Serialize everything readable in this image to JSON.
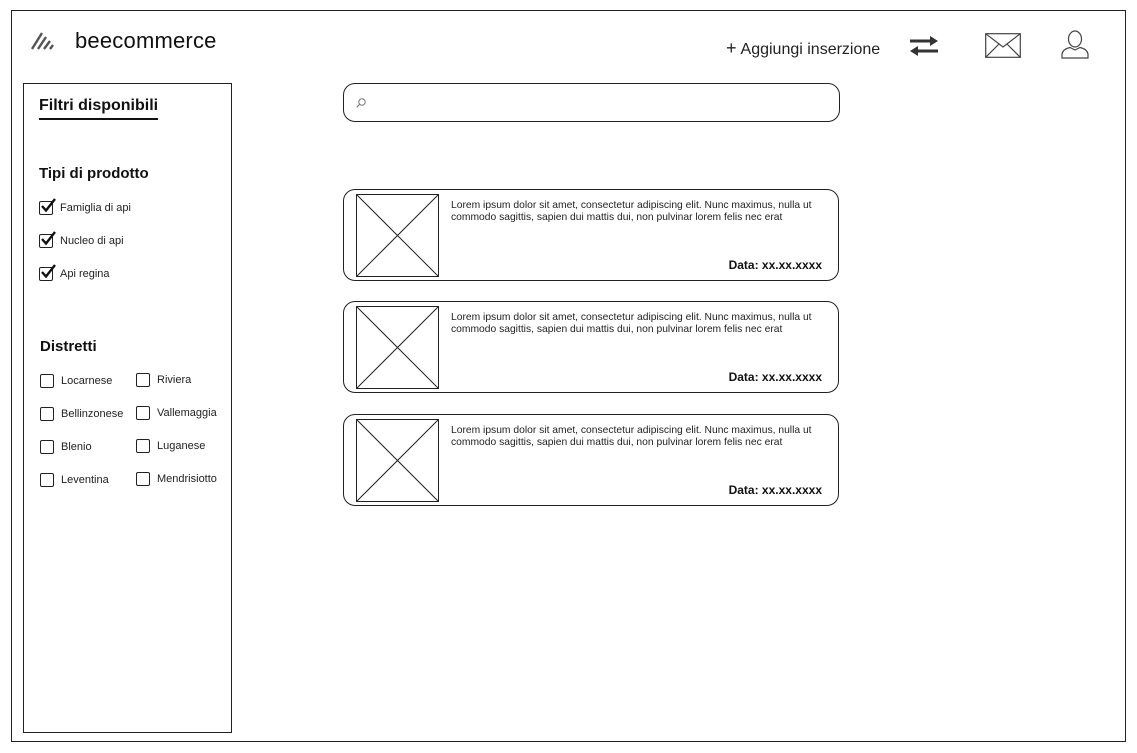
{
  "header": {
    "brand": "beecommerce",
    "add_listing_plus": "+",
    "add_listing_label": "Aggiungi inserzione",
    "icons": [
      "logo-icon",
      "swap-arrows-icon",
      "mail-icon",
      "user-icon"
    ]
  },
  "sidebar": {
    "title": "Filtri disponibili",
    "product_types": {
      "heading": "Tipi di prodotto",
      "items": [
        {
          "label": "Famiglia di api",
          "checked": true
        },
        {
          "label": "Nucleo di api",
          "checked": true
        },
        {
          "label": "Api regina",
          "checked": true
        }
      ]
    },
    "districts": {
      "heading": "Distretti",
      "items": [
        {
          "label": "Locarnese",
          "checked": false
        },
        {
          "label": "Riviera",
          "checked": false
        },
        {
          "label": "Bellinzonese",
          "checked": false
        },
        {
          "label": "Vallemaggia",
          "checked": false
        },
        {
          "label": "Blenio",
          "checked": false
        },
        {
          "label": "Luganese",
          "checked": false
        },
        {
          "label": "Leventina",
          "checked": false
        },
        {
          "label": "Mendrisiotto",
          "checked": false
        }
      ]
    }
  },
  "search": {
    "value": "",
    "placeholder": ""
  },
  "listings": [
    {
      "description": "Lorem ipsum dolor sit amet, consectetur adipiscing elit. Nunc maximus, nulla ut commodo sagittis, sapien dui mattis dui, non pulvinar lorem felis nec erat",
      "date": "Data: xx.xx.xxxx"
    },
    {
      "description": "Lorem ipsum dolor sit amet, consectetur adipiscing elit. Nunc maximus, nulla ut commodo sagittis, sapien dui mattis dui, non pulvinar lorem felis nec erat",
      "date": "Data: xx.xx.xxxx"
    },
    {
      "description": "Lorem ipsum dolor sit amet, consectetur adipiscing elit. Nunc maximus, nulla ut commodo sagittis, sapien dui mattis dui, non pulvinar lorem felis nec erat",
      "date": "Data: xx.xx.xxxx"
    }
  ]
}
